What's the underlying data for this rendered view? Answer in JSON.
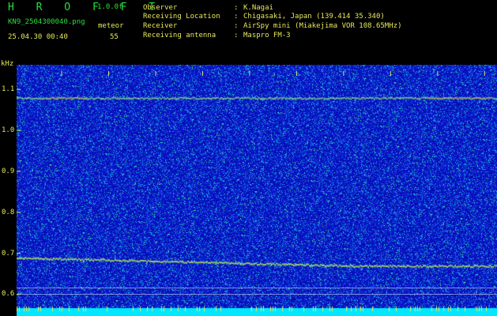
{
  "header": {
    "app_name": "H R O F F T",
    "version": "1.0.0f",
    "filename": "KN9_2504300040.png",
    "mode_label": "meteor",
    "datetime": "25.04.30 00:40",
    "count": "55",
    "info": [
      {
        "label": "Observer",
        "sep": ":",
        "value": "K.Nagai"
      },
      {
        "label": "Receiving Location",
        "sep": ":",
        "value": "Chigasaki, Japan (139.414 35.340)"
      },
      {
        "label": "Receiver",
        "sep": ":",
        "value": "AirSpy mini (Miakejima VOR 108.65MHz)"
      },
      {
        "label": "Receiving antenna",
        "sep": ":",
        "value": "Maspro FM-3"
      }
    ]
  },
  "chart_data": {
    "type": "heatmap",
    "ylabel": "kHz",
    "y_ticks": [
      "1.1",
      "1.0",
      "0.9",
      "0.8",
      "0.7",
      "0.6"
    ],
    "ylim": [
      0.57,
      1.16
    ],
    "x_ticks": [
      "0041",
      "0042",
      "0043",
      "0044",
      "0045",
      "0046",
      "0047",
      "0048",
      "0049",
      "0050"
    ],
    "signals": [
      {
        "freq_khz": 1.08,
        "note": "steady carrier"
      },
      {
        "freq_khz_start": 0.69,
        "freq_khz_end": 0.67,
        "note": "drifting carrier"
      }
    ]
  },
  "colors": {
    "background": "#0a14c8",
    "label": "#e8e85a",
    "header_text": "#28e03c",
    "bottom_band": "#00e8ff"
  }
}
